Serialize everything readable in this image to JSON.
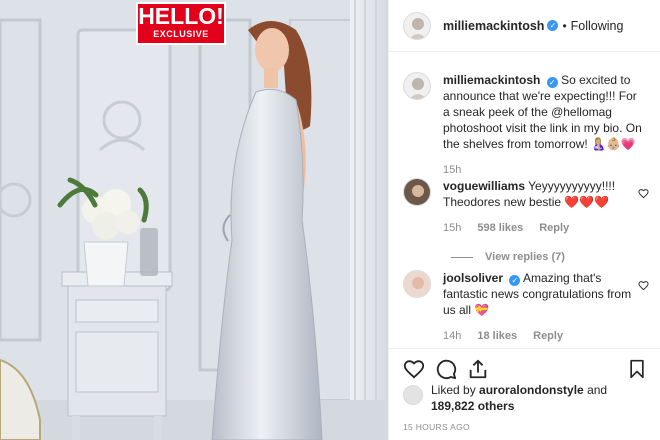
{
  "photo": {
    "badge_logo": "HELLO!",
    "badge_tag": "EXCLUSIVE"
  },
  "header": {
    "username": "milliemackintosh",
    "separator": "•",
    "follow_label": "Following"
  },
  "caption": {
    "username": "milliemackintosh",
    "text": "So excited to announce that we're expecting!!! For a sneak peek of the @hellomag photoshoot visit the link in my bio. On the shelves from tomorrow! 🤱🏼👶🏼💗",
    "time": "15h"
  },
  "comments": [
    {
      "username": "voguewilliams",
      "text": "Yeyyyyyyyyyy!!!! Theodores new bestie ❤️❤️❤️",
      "time": "15h",
      "likes": "598 likes",
      "reply_label": "Reply",
      "view_replies": "View replies (7)"
    },
    {
      "username": "joolsoliver",
      "text": "Amazing that's fantastic news congratulations from us all 💝",
      "time": "14h",
      "likes": "18 likes",
      "reply_label": "Reply"
    }
  ],
  "likes": {
    "prefix": "Liked by",
    "liker": "auroralondonstyle",
    "connector": "and",
    "others": "189,822 others"
  },
  "timestamp": "15 HOURS AGO",
  "icons": [
    "heart-icon",
    "comment-icon",
    "share-icon",
    "bookmark-icon",
    "verified-badge-icon"
  ],
  "colors": {
    "brand_red": "#e2001a",
    "verified_blue": "#3897f0",
    "muted": "#8e8e8e"
  }
}
